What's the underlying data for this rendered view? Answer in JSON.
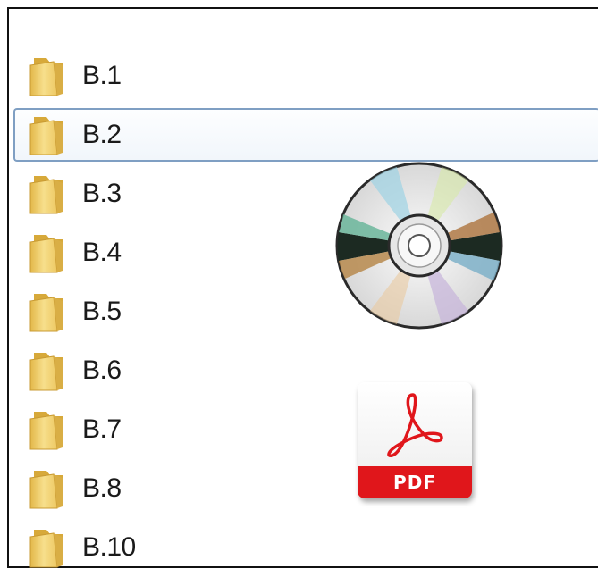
{
  "explorer": {
    "items": [
      {
        "label": "B.1",
        "icon": "folder-icon",
        "selected": false
      },
      {
        "label": "B.2",
        "icon": "folder-icon",
        "selected": true
      },
      {
        "label": "B.3",
        "icon": "folder-icon",
        "selected": false
      },
      {
        "label": "B.4",
        "icon": "folder-icon",
        "selected": false
      },
      {
        "label": "B.5",
        "icon": "folder-icon",
        "selected": false
      },
      {
        "label": "B.6",
        "icon": "folder-icon",
        "selected": false
      },
      {
        "label": "B.7",
        "icon": "folder-icon",
        "selected": false
      },
      {
        "label": "B.8",
        "icon": "folder-icon",
        "selected": false
      },
      {
        "label": "B.10",
        "icon": "folder-icon",
        "selected": false
      }
    ]
  },
  "cd": {
    "icon": "cd-disc-icon"
  },
  "pdf": {
    "icon": "pdf-file-icon",
    "label": "PDF"
  },
  "colors": {
    "selection_border": "#7f9fc3",
    "pdf_red": "#e0161b",
    "folder_yellow": "#f2d574"
  }
}
